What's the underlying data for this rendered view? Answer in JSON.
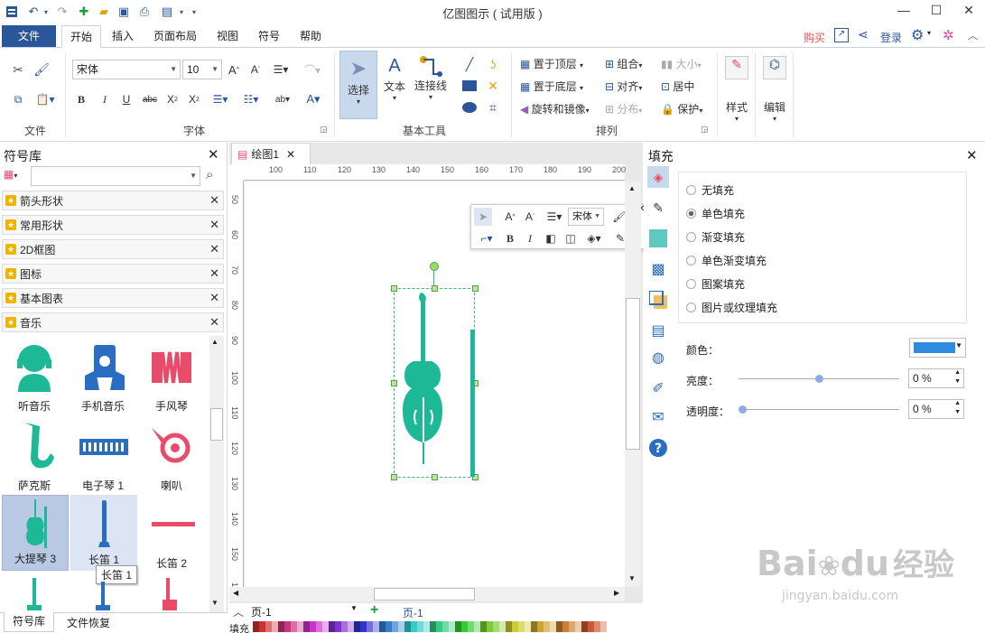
{
  "app": {
    "title": "亿图图示 ( 试用版 )",
    "window_controls": [
      "minimize-icon",
      "maximize-icon",
      "close-icon"
    ]
  },
  "menu": {
    "file": "文件",
    "tabs": [
      "开始",
      "插入",
      "页面布局",
      "视图",
      "符号",
      "帮助"
    ],
    "active_tab": "开始",
    "right": {
      "buy": "购买",
      "login": "登录"
    }
  },
  "ribbon": {
    "clipboard": {
      "label": "文件"
    },
    "font": {
      "label": "字体",
      "font_name": "宋体",
      "font_size": "10"
    },
    "tools": {
      "label": "基本工具",
      "select": "选择",
      "text": "文本",
      "connector": "连接线"
    },
    "arrange": {
      "label": "排列",
      "bring_front": "置于顶层",
      "send_back": "置于底层",
      "rotate": "旋转和镜像",
      "group": "组合",
      "align": "对齐",
      "distribute": "分布",
      "size": "大小",
      "center": "居中",
      "protect": "保护"
    },
    "style": "样式",
    "edit": "编辑"
  },
  "left_panel": {
    "title": "符号库",
    "search_placeholder": "",
    "categories": [
      "箭头形状",
      "常用形状",
      "2D框图",
      "图标",
      "基本图表",
      "音乐"
    ],
    "symbols": [
      "听音乐",
      "手机音乐",
      "手风琴",
      "萨克斯",
      "电子琴 1",
      "喇叭",
      "大提琴 3",
      "长笛 1",
      "长笛 2"
    ],
    "tooltip": "长笛 1",
    "bottom_tabs": [
      "符号库",
      "文件恢复"
    ]
  },
  "canvas": {
    "doc_tab": "绘图1",
    "hruler": [
      "100",
      "110",
      "120",
      "130",
      "140",
      "150",
      "160",
      "170",
      "180",
      "190",
      "200"
    ],
    "vruler": [
      "50",
      "60",
      "70",
      "80",
      "90",
      "100",
      "110",
      "120",
      "130",
      "140",
      "150",
      "160"
    ],
    "float_font": "宋体",
    "page_selector": "页-1",
    "page_tab": "页-1",
    "fill_label": "填充"
  },
  "right_panel": {
    "title": "填充",
    "options": [
      "无填充",
      "单色填充",
      "渐变填充",
      "单色渐变填充",
      "图案填充",
      "图片或纹理填充"
    ],
    "selected": "单色填充",
    "color_label": "颜色：",
    "color_value": "#2e8bde",
    "brightness_label": "亮度：",
    "brightness_value": "0 %",
    "transparency_label": "透明度：",
    "transparency_value": "0 %"
  },
  "colors": {
    "teal": "#1db997",
    "pink": "#e94b6a",
    "blue": "#2a6ec1",
    "accent": "#2b579a"
  },
  "watermark": {
    "text1": "Bai",
    "text2": "du",
    "text3": "经验",
    "url": "jingyan.baidu.com"
  }
}
